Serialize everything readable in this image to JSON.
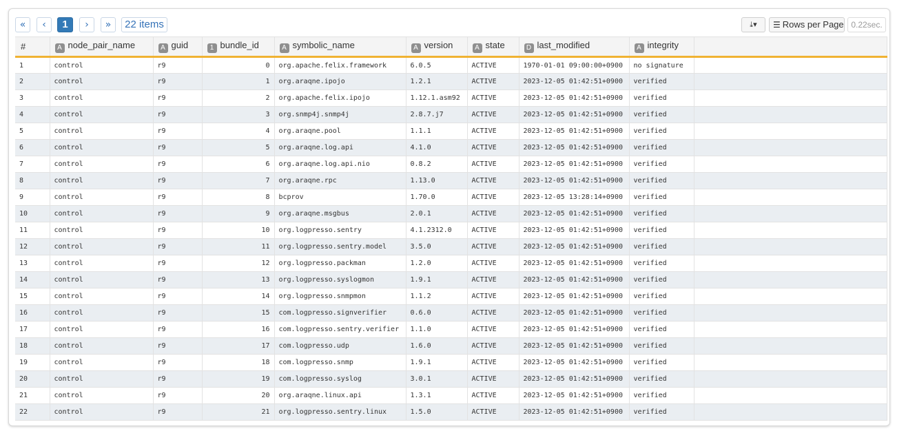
{
  "pagination": {
    "first": "«",
    "prev": "‹",
    "current": "1",
    "next": "›",
    "last": "»",
    "count": "22 items"
  },
  "toolbar": {
    "download_icon": "download-icon",
    "rows_per_page_label": "Rows per Page",
    "timing": "0.22sec."
  },
  "table": {
    "columns": [
      {
        "label": "#",
        "type_badge": ""
      },
      {
        "label": "node_pair_name",
        "type_badge": "A"
      },
      {
        "label": "guid",
        "type_badge": "A"
      },
      {
        "label": "bundle_id",
        "type_badge": "1"
      },
      {
        "label": "symbolic_name",
        "type_badge": "A"
      },
      {
        "label": "version",
        "type_badge": "A"
      },
      {
        "label": "state",
        "type_badge": "A"
      },
      {
        "label": "last_modified",
        "type_badge": "D"
      },
      {
        "label": "integrity",
        "type_badge": "A"
      }
    ],
    "rows": [
      [
        "1",
        "control",
        "r9",
        "0",
        "org.apache.felix.framework",
        "6.0.5",
        "ACTIVE",
        "1970-01-01 09:00:00+0900",
        "no signature"
      ],
      [
        "2",
        "control",
        "r9",
        "1",
        "org.araqne.ipojo",
        "1.2.1",
        "ACTIVE",
        "2023-12-05 01:42:51+0900",
        "verified"
      ],
      [
        "3",
        "control",
        "r9",
        "2",
        "org.apache.felix.ipojo",
        "1.12.1.asm92",
        "ACTIVE",
        "2023-12-05 01:42:51+0900",
        "verified"
      ],
      [
        "4",
        "control",
        "r9",
        "3",
        "org.snmp4j.snmp4j",
        "2.8.7.j7",
        "ACTIVE",
        "2023-12-05 01:42:51+0900",
        "verified"
      ],
      [
        "5",
        "control",
        "r9",
        "4",
        "org.araqne.pool",
        "1.1.1",
        "ACTIVE",
        "2023-12-05 01:42:51+0900",
        "verified"
      ],
      [
        "6",
        "control",
        "r9",
        "5",
        "org.araqne.log.api",
        "4.1.0",
        "ACTIVE",
        "2023-12-05 01:42:51+0900",
        "verified"
      ],
      [
        "7",
        "control",
        "r9",
        "6",
        "org.araqne.log.api.nio",
        "0.8.2",
        "ACTIVE",
        "2023-12-05 01:42:51+0900",
        "verified"
      ],
      [
        "8",
        "control",
        "r9",
        "7",
        "org.araqne.rpc",
        "1.13.0",
        "ACTIVE",
        "2023-12-05 01:42:51+0900",
        "verified"
      ],
      [
        "9",
        "control",
        "r9",
        "8",
        "bcprov",
        "1.70.0",
        "ACTIVE",
        "2023-12-05 13:28:14+0900",
        "verified"
      ],
      [
        "10",
        "control",
        "r9",
        "9",
        "org.araqne.msgbus",
        "2.0.1",
        "ACTIVE",
        "2023-12-05 01:42:51+0900",
        "verified"
      ],
      [
        "11",
        "control",
        "r9",
        "10",
        "org.logpresso.sentry",
        "4.1.2312.0",
        "ACTIVE",
        "2023-12-05 01:42:51+0900",
        "verified"
      ],
      [
        "12",
        "control",
        "r9",
        "11",
        "org.logpresso.sentry.model",
        "3.5.0",
        "ACTIVE",
        "2023-12-05 01:42:51+0900",
        "verified"
      ],
      [
        "13",
        "control",
        "r9",
        "12",
        "org.logpresso.packman",
        "1.2.0",
        "ACTIVE",
        "2023-12-05 01:42:51+0900",
        "verified"
      ],
      [
        "14",
        "control",
        "r9",
        "13",
        "org.logpresso.syslogmon",
        "1.9.1",
        "ACTIVE",
        "2023-12-05 01:42:51+0900",
        "verified"
      ],
      [
        "15",
        "control",
        "r9",
        "14",
        "org.logpresso.snmpmon",
        "1.1.2",
        "ACTIVE",
        "2023-12-05 01:42:51+0900",
        "verified"
      ],
      [
        "16",
        "control",
        "r9",
        "15",
        "com.logpresso.signverifier",
        "0.6.0",
        "ACTIVE",
        "2023-12-05 01:42:51+0900",
        "verified"
      ],
      [
        "17",
        "control",
        "r9",
        "16",
        "com.logpresso.sentry.verifier",
        "1.1.0",
        "ACTIVE",
        "2023-12-05 01:42:51+0900",
        "verified"
      ],
      [
        "18",
        "control",
        "r9",
        "17",
        "com.logpresso.udp",
        "1.6.0",
        "ACTIVE",
        "2023-12-05 01:42:51+0900",
        "verified"
      ],
      [
        "19",
        "control",
        "r9",
        "18",
        "com.logpresso.snmp",
        "1.9.1",
        "ACTIVE",
        "2023-12-05 01:42:51+0900",
        "verified"
      ],
      [
        "20",
        "control",
        "r9",
        "19",
        "com.logpresso.syslog",
        "3.0.1",
        "ACTIVE",
        "2023-12-05 01:42:51+0900",
        "verified"
      ],
      [
        "21",
        "control",
        "r9",
        "20",
        "org.araqne.linux.api",
        "1.3.1",
        "ACTIVE",
        "2023-12-05 01:42:51+0900",
        "verified"
      ],
      [
        "22",
        "control",
        "r9",
        "21",
        "org.logpresso.sentry.linux",
        "1.5.0",
        "ACTIVE",
        "2023-12-05 01:42:51+0900",
        "verified"
      ]
    ]
  }
}
